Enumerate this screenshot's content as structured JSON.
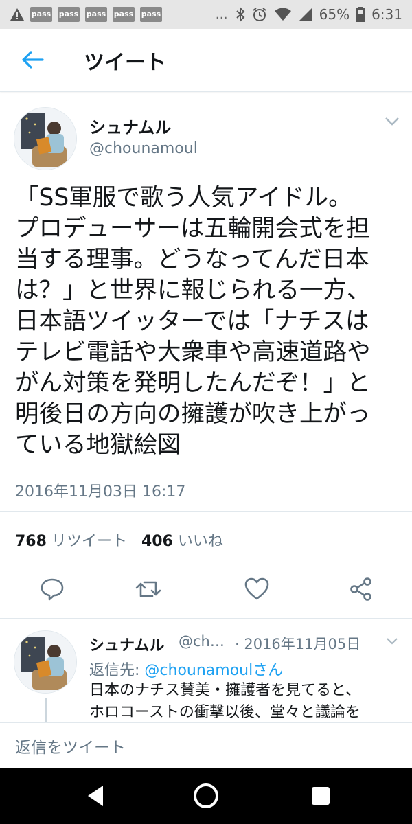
{
  "status_bar": {
    "pass_labels": [
      "pass",
      "pass",
      "pass",
      "pass",
      "pass"
    ],
    "more": "…",
    "battery_pct": "65%",
    "time": "6:31"
  },
  "header": {
    "title": "ツイート"
  },
  "tweet": {
    "name": "シュナムル",
    "handle": "@chounamoul",
    "text": "「SS軍服で歌う人気アイドル。\nプロデューサーは五輪開会式を担\n当する理事。どうなってんだ日本\nは？」と世界に報じられる一方、\n日本語ツイッターでは「ナチスは\nテレビ電話や大衆車や高速道路や\nがん対策を発明したんだぞ！」と\n明後日の方向の擁護が吹き上がっ\nている地獄絵図",
    "timestamp": "2016年11月03日 16:17",
    "retweet_count": "768",
    "retweet_label": "リツイート",
    "like_count": "406",
    "like_label": "いいね"
  },
  "reply": {
    "name": "シュナムル",
    "handle": "@ch…",
    "date": "· 2016年11月05日",
    "reply_to_prefix": "返信先: ",
    "reply_to_user": "@chounamoulさん",
    "text": "日本のナチス賛美・擁護者を見てると、\nホロコーストの衝撃以後、堂々と議論を"
  },
  "compose": {
    "placeholder": "返信をツイート"
  },
  "colors": {
    "accent": "#1da1f2",
    "muted": "#657786",
    "text": "#14171a"
  }
}
